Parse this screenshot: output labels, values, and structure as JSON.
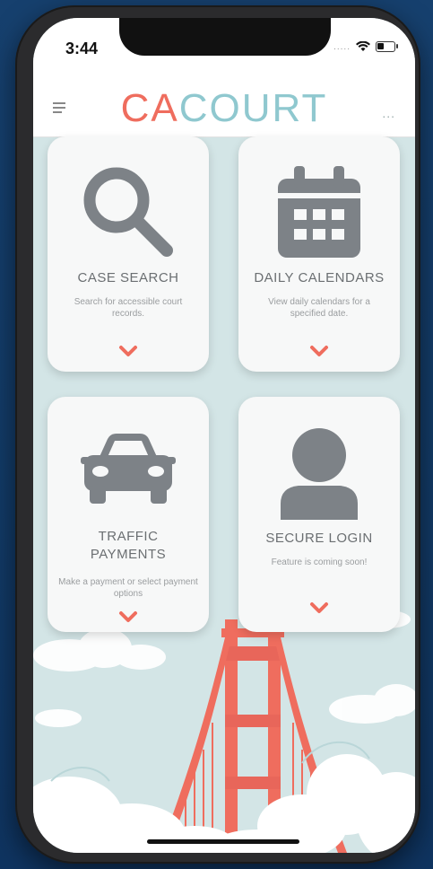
{
  "status_bar": {
    "time": "3:44",
    "signal": "....."
  },
  "app_bar": {
    "brand_prefix": "CA",
    "brand_suffix": "COURT",
    "menu_icon": "hamburger-icon",
    "more_icon": "more-dots-icon",
    "more_label": "..."
  },
  "cards": [
    {
      "title": "CASE SEARCH",
      "description": "Search for accessible court records.",
      "icon": "magnifier-icon"
    },
    {
      "title": "DAILY CALENDARS",
      "description": "View daily calendars for a specified date.",
      "icon": "calendar-icon"
    },
    {
      "title_line1": "TRAFFIC",
      "title_line2": "PAYMENTS",
      "description": "Make a payment or select payment options",
      "icon": "car-icon"
    },
    {
      "title": "SECURE LOGIN",
      "description": "Feature is coming soon!",
      "icon": "user-icon"
    }
  ],
  "colors": {
    "accent": "#ef6d5e",
    "brand_light": "#8fc8cf",
    "icon_gray": "#7d8287",
    "background": "#d3e5e6"
  }
}
